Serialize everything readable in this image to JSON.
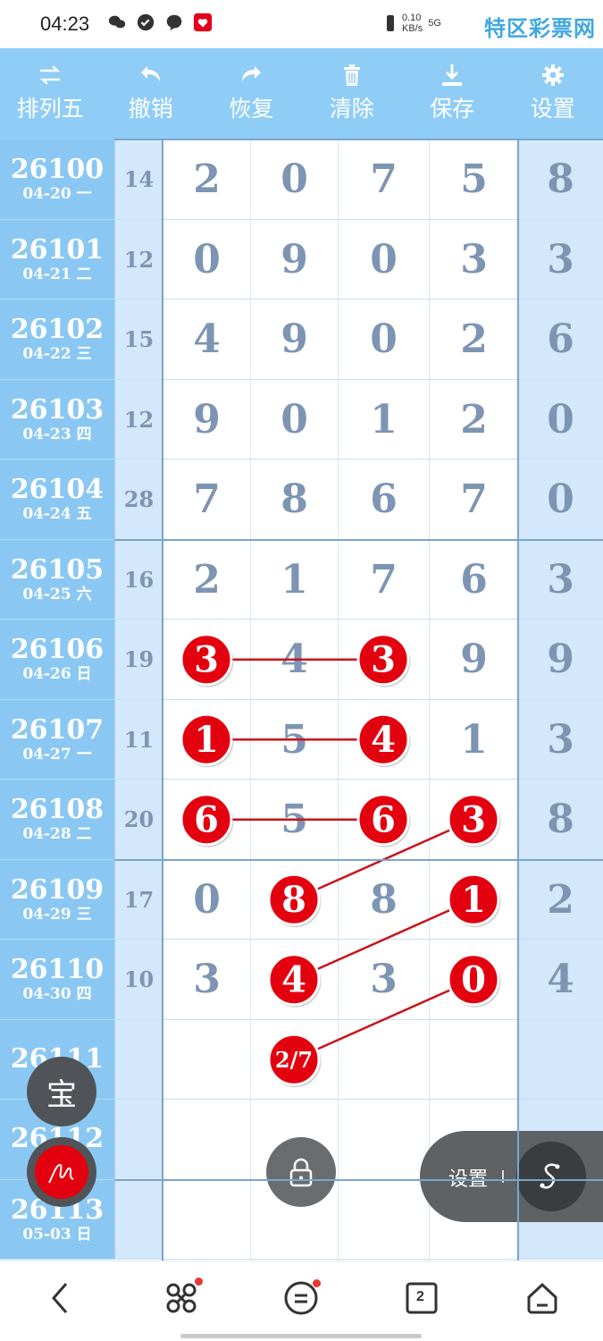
{
  "status_bar": {
    "time": "04:23",
    "net_speed": "0.10",
    "net_unit": "KB/s",
    "network": "5G",
    "watermark": "特区彩票网"
  },
  "toolbar": {
    "items": [
      {
        "label": "排列五",
        "icon": "swap-icon"
      },
      {
        "label": "撤销",
        "icon": "undo-icon"
      },
      {
        "label": "恢复",
        "icon": "redo-icon"
      },
      {
        "label": "清除",
        "icon": "trash-icon"
      },
      {
        "label": "保存",
        "icon": "download-icon"
      },
      {
        "label": "设置",
        "icon": "gear-icon"
      }
    ]
  },
  "rows": [
    {
      "issue": "26100",
      "date": "04-20 一",
      "sum": "14",
      "digits": [
        "2",
        "0",
        "7",
        "5",
        "8"
      ]
    },
    {
      "issue": "26101",
      "date": "04-21 二",
      "sum": "12",
      "digits": [
        "0",
        "9",
        "0",
        "3",
        "3"
      ]
    },
    {
      "issue": "26102",
      "date": "04-22 三",
      "sum": "15",
      "digits": [
        "4",
        "9",
        "0",
        "2",
        "6"
      ]
    },
    {
      "issue": "26103",
      "date": "04-23 四",
      "sum": "12",
      "digits": [
        "9",
        "0",
        "1",
        "2",
        "0"
      ]
    },
    {
      "issue": "26104",
      "date": "04-24 五",
      "sum": "28",
      "digits": [
        "7",
        "8",
        "6",
        "7",
        "0"
      ]
    },
    {
      "issue": "26105",
      "date": "04-25 六",
      "sum": "16",
      "digits": [
        "2",
        "1",
        "7",
        "6",
        "3"
      ]
    },
    {
      "issue": "26106",
      "date": "04-26 日",
      "sum": "19",
      "digits": [
        "3",
        "4",
        "3",
        "9",
        "9"
      ]
    },
    {
      "issue": "26107",
      "date": "04-27 一",
      "sum": "11",
      "digits": [
        "1",
        "5",
        "4",
        "1",
        "3"
      ]
    },
    {
      "issue": "26108",
      "date": "04-28 二",
      "sum": "20",
      "digits": [
        "6",
        "5",
        "6",
        "3",
        "8"
      ]
    },
    {
      "issue": "26109",
      "date": "04-29 三",
      "sum": "17",
      "digits": [
        "0",
        "8",
        "8",
        "1",
        "2"
      ]
    },
    {
      "issue": "26110",
      "date": "04-30 四",
      "sum": "10",
      "digits": [
        "3",
        "4",
        "3",
        "0",
        "4"
      ]
    },
    {
      "issue": "26111",
      "date": "",
      "sum": "",
      "digits": [
        "",
        "",
        "",
        "",
        ""
      ]
    },
    {
      "issue": "26112",
      "date": "",
      "sum": "",
      "digits": [
        "",
        "",
        "",
        "",
        ""
      ]
    },
    {
      "issue": "26113",
      "date": "05-03 日",
      "sum": "",
      "digits": [
        "",
        "",
        "",
        "",
        ""
      ]
    }
  ],
  "marks": {
    "balls": [
      {
        "row": 6,
        "col": 0,
        "text": "3"
      },
      {
        "row": 6,
        "col": 2,
        "text": "3"
      },
      {
        "row": 7,
        "col": 0,
        "text": "1"
      },
      {
        "row": 7,
        "col": 2,
        "text": "4"
      },
      {
        "row": 8,
        "col": 0,
        "text": "6"
      },
      {
        "row": 8,
        "col": 2,
        "text": "6"
      },
      {
        "row": 8,
        "col": 3,
        "text": "3"
      },
      {
        "row": 9,
        "col": 1,
        "text": "8"
      },
      {
        "row": 9,
        "col": 3,
        "text": "1"
      },
      {
        "row": 10,
        "col": 1,
        "text": "4"
      },
      {
        "row": 10,
        "col": 3,
        "text": "0"
      },
      {
        "row": 11,
        "col": 1,
        "text": "2/7"
      }
    ],
    "lines": [
      {
        "from": [
          6,
          0
        ],
        "to": [
          6,
          2
        ]
      },
      {
        "from": [
          7,
          0
        ],
        "to": [
          7,
          2
        ]
      },
      {
        "from": [
          8,
          0
        ],
        "to": [
          8,
          2
        ]
      },
      {
        "from": [
          8,
          3
        ],
        "to": [
          9,
          1
        ]
      },
      {
        "from": [
          9,
          3
        ],
        "to": [
          10,
          1
        ]
      },
      {
        "from": [
          10,
          3
        ],
        "to": [
          11,
          1
        ]
      }
    ],
    "ball_color": "#e3000f",
    "line_color": "#c8141e"
  },
  "floating": {
    "bao_label": "宝",
    "settings_label": "设置",
    "pen_icon": "signature-pen-icon",
    "lock_icon": "lock-icon",
    "s_icon": "s-swipe-icon"
  },
  "navbar": {
    "items": [
      "back-icon",
      "apps-icon",
      "menu-icon",
      "tabs-icon",
      "home-icon"
    ],
    "tabs_count": "2"
  },
  "colors": {
    "toolbar_bg": "#8fcdf7",
    "issue_bg": "#8ac8f3",
    "side_bg": "#d3e8fa",
    "digit_color": "#7d95b3"
  }
}
